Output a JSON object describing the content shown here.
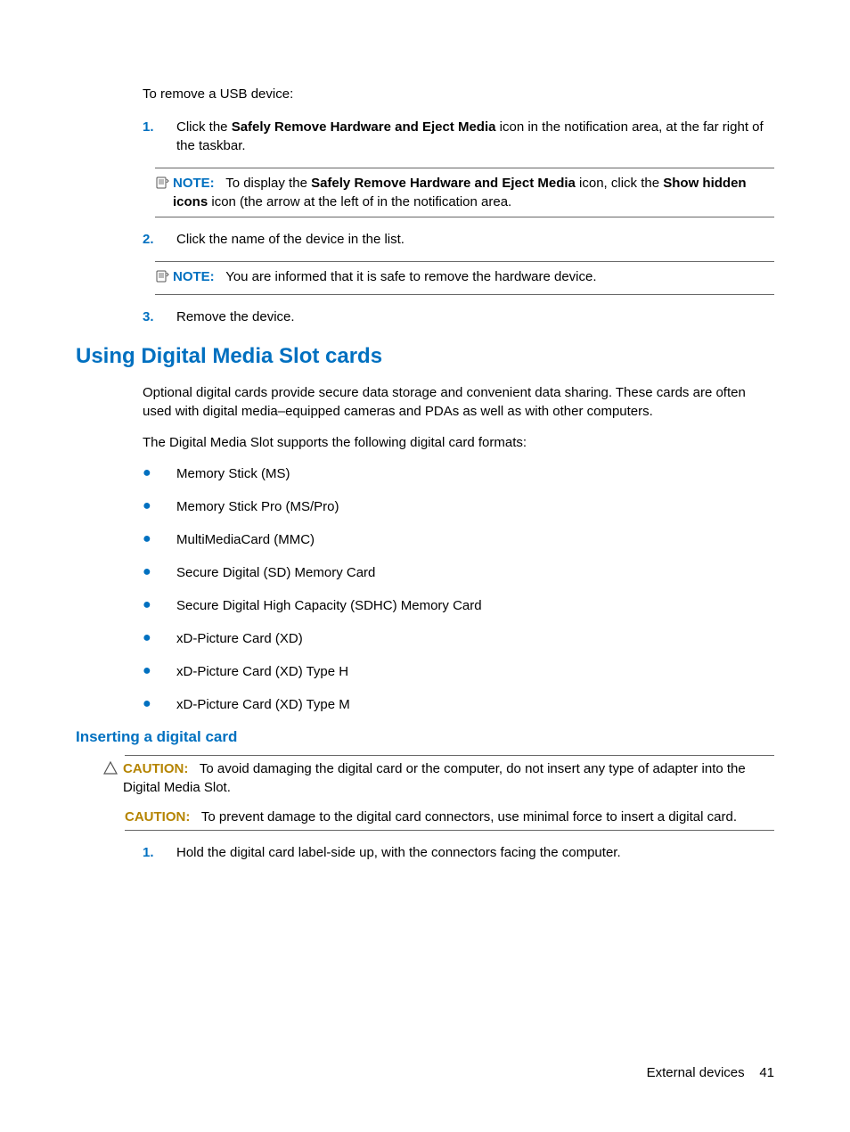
{
  "intro": "To remove a USB device:",
  "steps_top": [
    {
      "num": "1.",
      "parts": [
        "Click the ",
        "Safely Remove Hardware and Eject Media",
        " icon in the notification area, at the far right of the taskbar."
      ],
      "note": {
        "label": "NOTE:",
        "parts": [
          "To display the ",
          "Safely Remove Hardware and Eject Media",
          " icon, click the ",
          "Show hidden icons",
          " icon (the arrow at the left of in the notification area."
        ]
      }
    },
    {
      "num": "2.",
      "parts": [
        "Click the name of the device in the list."
      ],
      "note": {
        "label": "NOTE:",
        "parts": [
          "You are informed that it is safe to remove the hardware device."
        ]
      }
    },
    {
      "num": "3.",
      "parts": [
        "Remove the device."
      ]
    }
  ],
  "h2": "Using Digital Media Slot cards",
  "p1": "Optional digital cards provide secure data storage and convenient data sharing. These cards are often used with digital media–equipped cameras and PDAs as well as with other computers.",
  "p2": "The Digital Media Slot supports the following digital card formats:",
  "bullets": [
    "Memory Stick (MS)",
    "Memory Stick Pro (MS/Pro)",
    "MultiMediaCard (MMC)",
    "Secure Digital (SD) Memory Card",
    "Secure Digital High Capacity (SDHC) Memory Card",
    "xD-Picture Card (XD)",
    "xD-Picture Card (XD) Type H",
    "xD-Picture Card (XD) Type M"
  ],
  "h3": "Inserting a digital card",
  "caution1": {
    "label": "CAUTION:",
    "text": "To avoid damaging the digital card or the computer, do not insert any type of adapter into the Digital Media Slot."
  },
  "caution2": {
    "label": "CAUTION:",
    "text": "To prevent damage to the digital card connectors, use minimal force to insert a digital card."
  },
  "steps_bottom": [
    {
      "num": "1.",
      "text": "Hold the digital card label-side up, with the connectors facing the computer."
    }
  ],
  "footer_section": "External devices",
  "footer_page": "41"
}
